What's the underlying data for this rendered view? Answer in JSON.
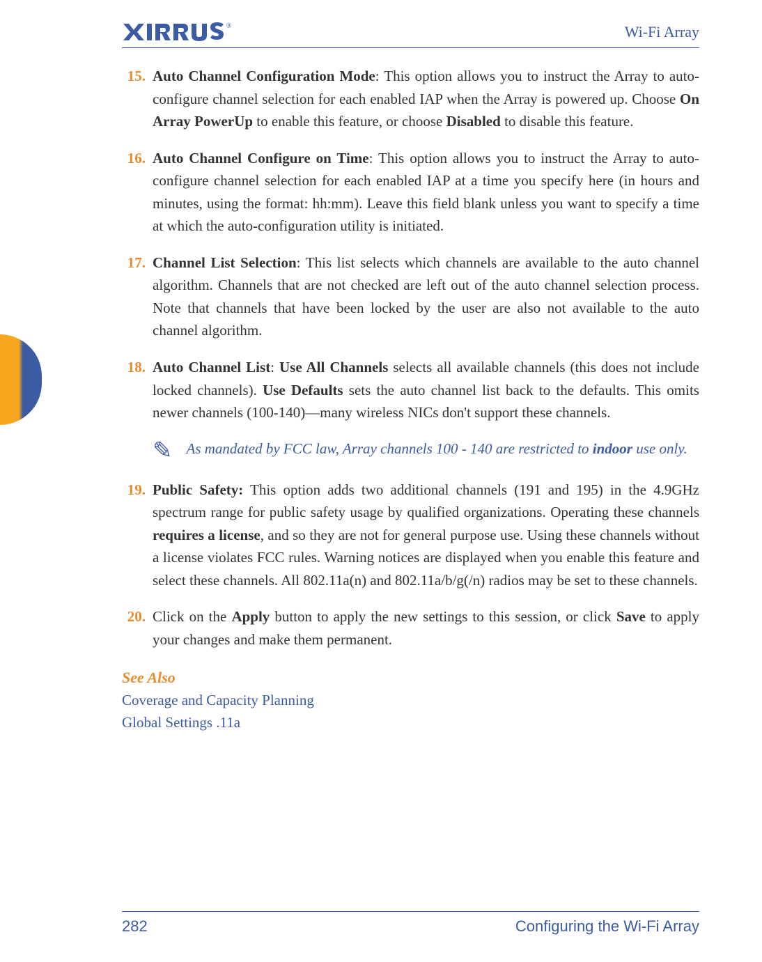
{
  "header": {
    "logo_text": "XIRRUS",
    "title": "Wi-Fi Array"
  },
  "items": [
    {
      "num": "15.",
      "title": "Auto Channel Configuration Mode",
      "pre": ": This option allows you to instruct the Array to auto-configure channel selection for each enabled IAP when the Array is powered up. Choose ",
      "b1": "On Array PowerUp",
      "mid1": " to enable this feature, or choose ",
      "b2": "Disabled",
      "post": " to disable this feature."
    },
    {
      "num": "16.",
      "title": "Auto Channel Configure on Time",
      "pre": ": This option allows you to instruct the Array to auto-configure channel selection for each enabled IAP at a time you specify here (in hours and minutes, using the format: hh:mm). Leave this field blank unless you want to specify a time at which the auto-configuration utility is initiated."
    },
    {
      "num": "17.",
      "title": "Channel List Selection",
      "pre": ": This list selects which channels are available to the auto channel algorithm. Channels that are not checked are left out of the auto channel selection process. Note that channels that have been locked by the user are also not available to the auto channel algorithm."
    },
    {
      "num": "18.",
      "title": "Auto Channel List",
      "pre": ": ",
      "b1": "Use All Channels",
      "mid1": " selects all available channels (this does not include locked channels). ",
      "b2": "Use Defaults",
      "post": " sets the auto channel list back to the defaults. This omits newer channels (100-140)—many wireless NICs don't support these channels."
    },
    {
      "num": "19.",
      "title": "Public Safety:",
      "pre": " This option adds two additional channels (191 and 195) in the 4.9GHz spectrum range for public safety usage by qualified organizations. Operating these channels ",
      "b1": "requires a license",
      "mid1": ", and so they are not for general purpose use. Using these channels without a license violates FCC rules. Warning notices are displayed when you enable this feature and select these channels. All 802.11a(n) and 802.11a/b/g(/n) radios may be set to these channels."
    },
    {
      "num": "20.",
      "pre": "Click on the ",
      "b1": "Apply",
      "mid1": " button to apply the new settings to this session, or click ",
      "b2": "Save",
      "post": " to apply your changes and make them permanent."
    }
  ],
  "note": {
    "pre": "As mandated by FCC law, Array channels 100 - 140 are restricted to ",
    "bold": "indoor",
    "post": " use only."
  },
  "see_also": {
    "header": "See Also",
    "links": [
      "Coverage and Capacity Planning",
      "Global Settings .11a"
    ]
  },
  "footer": {
    "page_num": "282",
    "title": "Configuring the Wi-Fi Array"
  }
}
